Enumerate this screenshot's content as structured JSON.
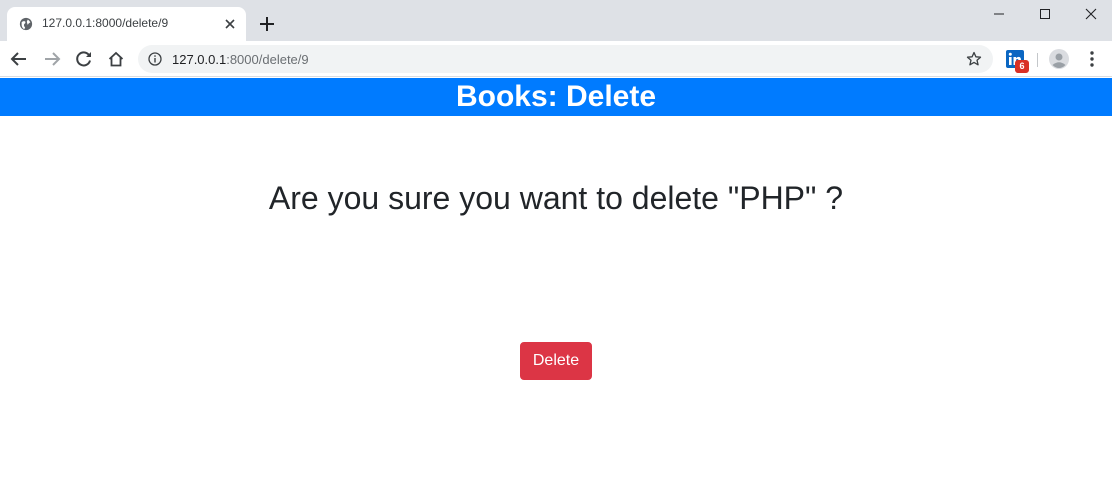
{
  "browser": {
    "tab": {
      "title": "127.0.0.1:8000/delete/9",
      "favicon": "globe-icon"
    },
    "address": {
      "host": "127.0.0.1",
      "path": ":8000/delete/9"
    },
    "extension_badge": "6"
  },
  "page": {
    "header_title": "Books: Delete",
    "confirm_message": "Are you sure you want to delete \"PHP\" ?",
    "delete_label": "Delete"
  },
  "colors": {
    "header_bg": "#007bff",
    "danger": "#dc3545",
    "tabstrip_bg": "#dee1e6"
  }
}
